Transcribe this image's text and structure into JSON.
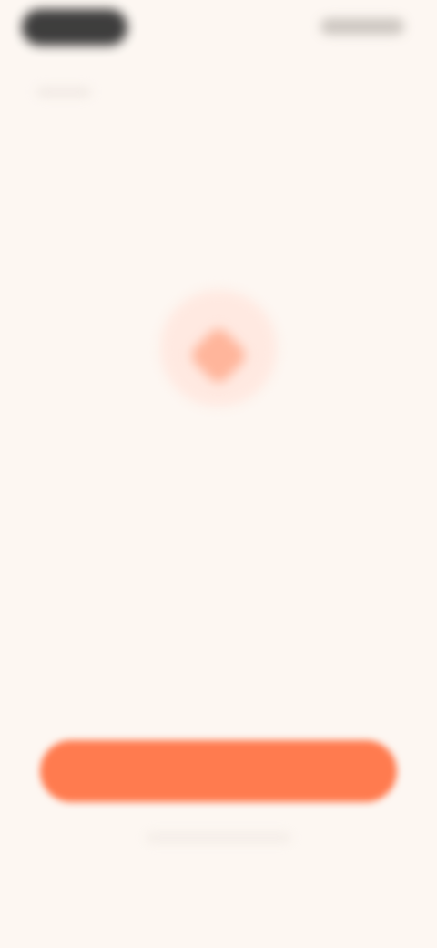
{
  "colors": {
    "background": "#fdf7f2",
    "accent": "#ff7b4f",
    "accent_soft": "#ffe9e1",
    "text_primary": "#3a3a3a",
    "text_secondary": "#a59f99"
  },
  "topbar": {
    "left_pill_icon": "status-pill",
    "right_pill_icon": "status-indicators"
  },
  "hero": {
    "icon": "heart-icon",
    "title": "",
    "subtitle": ""
  },
  "cta": {
    "label": ""
  }
}
